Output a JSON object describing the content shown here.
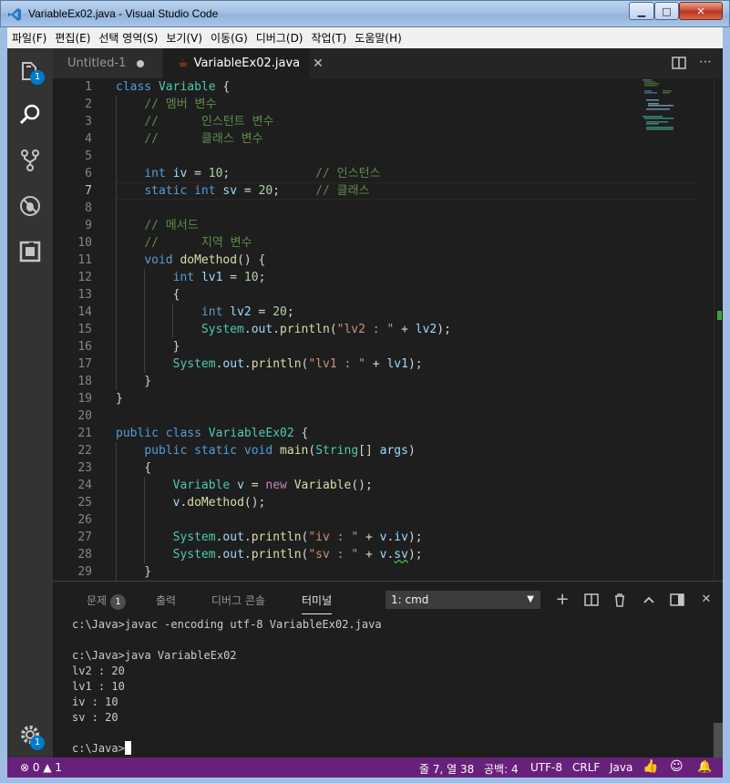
{
  "window": {
    "title": "VariableEx02.java - Visual Studio Code",
    "minimize": "▁",
    "maximize": "□",
    "close": "✕"
  },
  "menu": [
    "파일(F)",
    "편집(E)",
    "선택 영역(S)",
    "보기(V)",
    "이동(G)",
    "디버그(D)",
    "작업(T)",
    "도움말(H)"
  ],
  "activity": {
    "explorer_badge": "1",
    "settings_badge": "1"
  },
  "tabs": [
    {
      "label": "Untitled-1",
      "dirty": true
    },
    {
      "label": "VariableEx02.java",
      "icon": "java-icon",
      "close": "✕"
    }
  ],
  "editor": {
    "line_numbers": [
      "1",
      "2",
      "3",
      "4",
      "5",
      "6",
      "7",
      "8",
      "9",
      "10",
      "11",
      "12",
      "13",
      "14",
      "15",
      "16",
      "17",
      "18",
      "19",
      "20",
      "21",
      "22",
      "23",
      "24",
      "25",
      "26",
      "27",
      "28",
      "29"
    ]
  },
  "panel": {
    "tabs": [
      {
        "label": "문제",
        "badge": "1"
      },
      {
        "label": "출력"
      },
      {
        "label": "디버그 콘솔"
      },
      {
        "label": "터미널"
      }
    ],
    "terminal_select": "1: cmd",
    "terminal_lines": [
      "c:\\Java>javac -encoding utf-8 VariableEx02.java",
      "",
      "c:\\Java>java VariableEx02",
      "lv2 : 20",
      "lv1 : 10",
      "iv : 10",
      "sv : 20",
      "",
      "c:\\Java>"
    ]
  },
  "status": {
    "errors": "0",
    "warnings": "1",
    "position": "줄 7, 열 38",
    "spaces": "공백: 4",
    "encoding": "UTF-8",
    "eol": "CRLF",
    "language": "Java"
  },
  "colors": {
    "statusbar": "#68217a",
    "accent": "#007acc",
    "keyword": "#569cd6",
    "type": "#4ec9b0",
    "comment": "#608b4e",
    "string": "#ce9178"
  }
}
